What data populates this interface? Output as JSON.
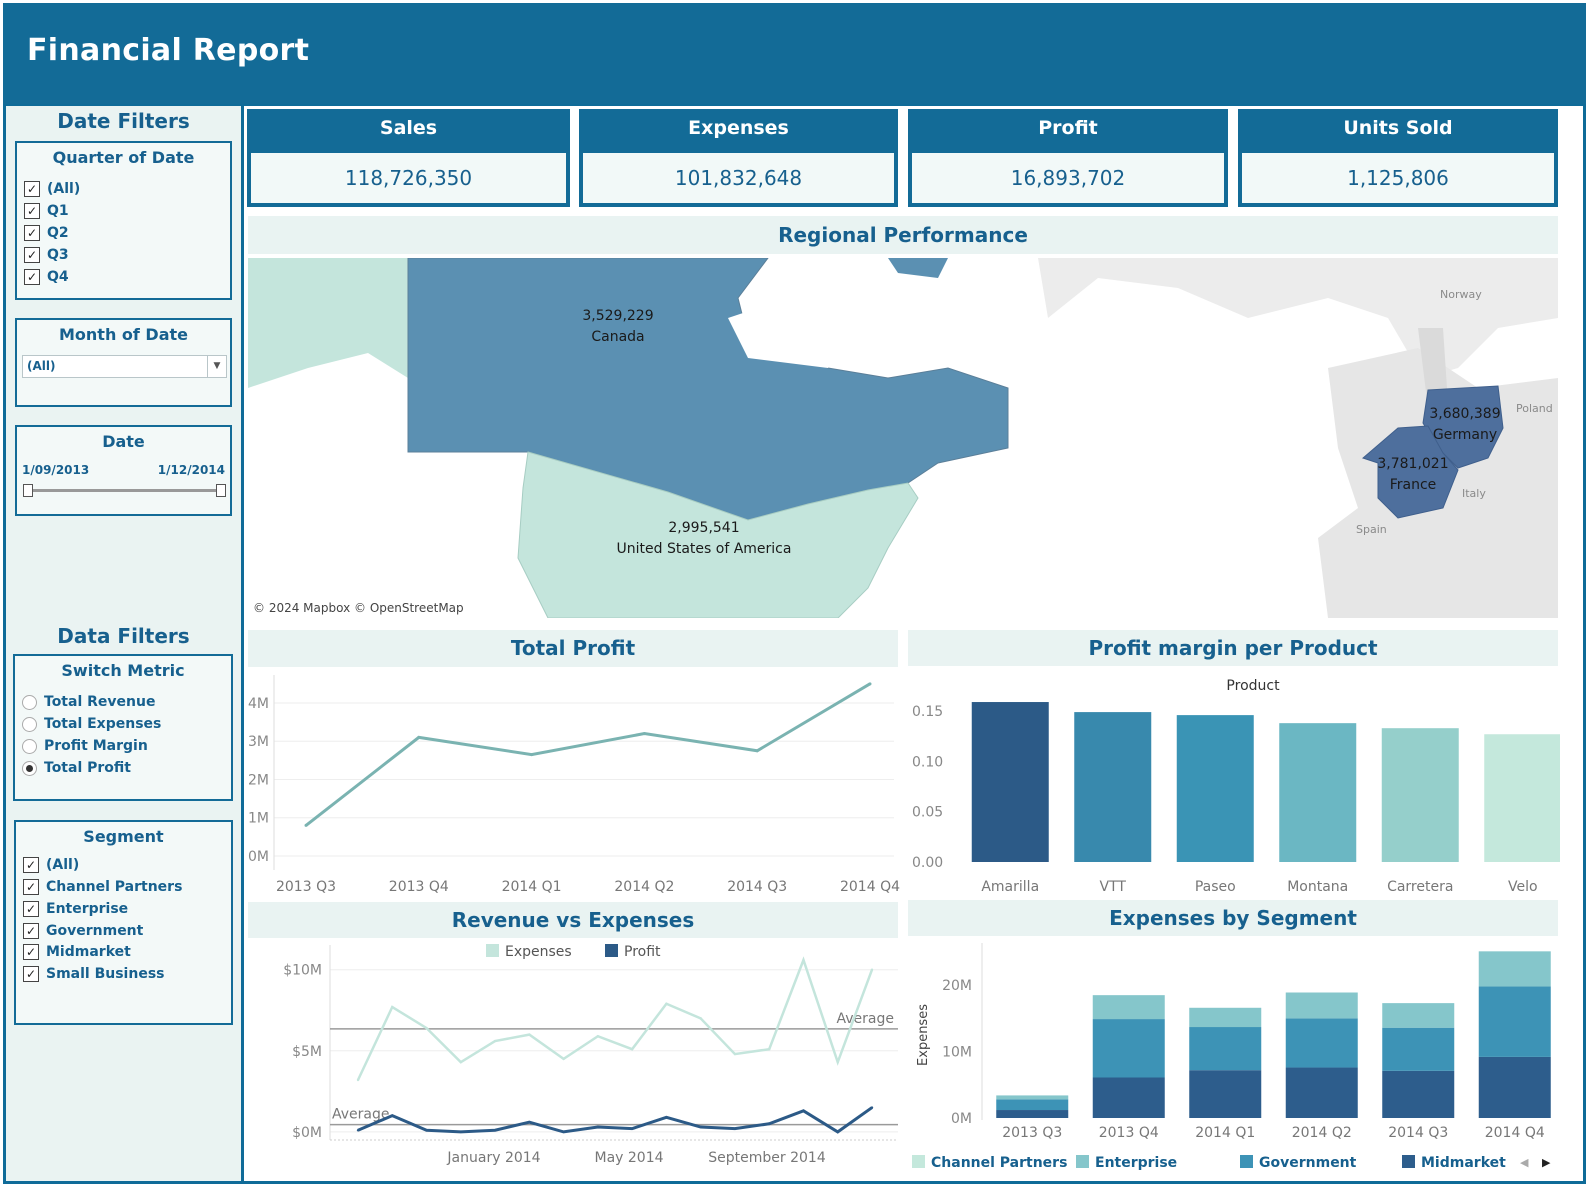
{
  "header": {
    "title": "Financial Report"
  },
  "sidebar": {
    "date_filters_heading": "Date Filters",
    "quarter": {
      "title": "Quarter of Date",
      "items": [
        "(All)",
        "Q1",
        "Q2",
        "Q3",
        "Q4"
      ]
    },
    "month": {
      "title": "Month of Date",
      "value": "(All)"
    },
    "date": {
      "title": "Date",
      "start": "1/09/2013",
      "end": "1/12/2014"
    },
    "data_filters_heading": "Data Filters",
    "switch_metric": {
      "title": "Switch Metric",
      "options": [
        "Total Revenue",
        "Total Expenses",
        "Profit Margin",
        "Total Profit"
      ],
      "selected": "Total Profit"
    },
    "segment": {
      "title": "Segment",
      "items": [
        "(All)",
        "Channel Partners",
        "Enterprise",
        "Government",
        "Midmarket",
        "Small Business"
      ]
    }
  },
  "kpis": [
    {
      "title": "Sales",
      "value": "118,726,350"
    },
    {
      "title": "Expenses",
      "value": "101,832,648"
    },
    {
      "title": "Profit",
      "value": "16,893,702"
    },
    {
      "title": "Units Sold",
      "value": "1,125,806"
    }
  ],
  "map": {
    "title": "Regional Performance",
    "attribution": "© 2024 Mapbox © OpenStreetMap",
    "regions": [
      {
        "name": "Canada",
        "value": "3,529,229"
      },
      {
        "name": "United States of America",
        "value": "2,995,541"
      },
      {
        "name": "Germany",
        "value": "3,680,389"
      },
      {
        "name": "France",
        "value": "3,781,021"
      }
    ],
    "basemap_labels": [
      "Norway",
      "Poland",
      "Italy",
      "Spain"
    ],
    "colors": {
      "canada": "#5b90b2",
      "usa": "#c4e5dc",
      "europe_selected": "#4e6f9d",
      "land": "#e6e6e6"
    }
  },
  "chart_data": [
    {
      "type": "line",
      "title": "Total Profit",
      "categories": [
        "2013 Q3",
        "2013 Q4",
        "2014 Q1",
        "2014 Q2",
        "2014 Q3",
        "2014 Q4"
      ],
      "series": [
        {
          "values": [
            0.8,
            3.1,
            2.65,
            3.2,
            2.75,
            4.5
          ]
        }
      ],
      "y_tick_labels": [
        "0M",
        "1M",
        "2M",
        "3M",
        "4M"
      ],
      "ylim": [
        0,
        4.6
      ],
      "unit": "millions",
      "color": "#7ab3b1"
    },
    {
      "type": "bar",
      "title": "Profit margin per Product",
      "header": "Product",
      "categories": [
        "Amarilla",
        "VTT",
        "Paseo",
        "Montana",
        "Carretera",
        "Velo"
      ],
      "values": [
        0.159,
        0.149,
        0.146,
        0.138,
        0.133,
        0.127
      ],
      "colors": [
        "#2c5a87",
        "#3889ad",
        "#3a94b5",
        "#6bb7c3",
        "#95cfcb",
        "#c4e8dc"
      ],
      "y_tick_labels": [
        "0.00",
        "0.05",
        "0.10",
        "0.15"
      ],
      "ylim": [
        0,
        0.165
      ]
    },
    {
      "type": "line",
      "title": "Revenue vs Expenses",
      "legend": [
        "Expenses",
        "Profit"
      ],
      "x_tick_labels": [
        "January 2014",
        "May 2014",
        "September 2014"
      ],
      "y_tick_labels": [
        "$0M",
        "$5M",
        "$10M"
      ],
      "ylim": [
        -0.5,
        10.6
      ],
      "series": [
        {
          "name": "Expenses",
          "color": "#c4e5dc",
          "values": [
            3.2,
            7.7,
            6.4,
            4.3,
            5.6,
            6.0,
            4.5,
            5.9,
            5.1,
            7.9,
            7.0,
            4.8,
            5.1,
            10.6,
            4.3,
            10.0
          ]
        },
        {
          "name": "Profit",
          "color": "#2c5a87",
          "values": [
            0.1,
            1.0,
            0.1,
            0.0,
            0.1,
            0.6,
            0.0,
            0.3,
            0.2,
            0.9,
            0.3,
            0.2,
            0.5,
            1.3,
            0.0,
            1.5
          ]
        }
      ],
      "averages": {
        "label": "Average",
        "expenses": 6.35,
        "profit": 0.45
      }
    },
    {
      "type": "bar",
      "title": "Expenses by Segment",
      "stacked": true,
      "ylabel": "Expenses",
      "categories": [
        "2013 Q3",
        "2013 Q4",
        "2014 Q1",
        "2014 Q2",
        "2014 Q3",
        "2014 Q4"
      ],
      "y_tick_labels": [
        "0M",
        "10M",
        "20M"
      ],
      "ylim": [
        0,
        25
      ],
      "legend": [
        "Channel Partners",
        "Enterprise",
        "Government",
        "Midmarket"
      ],
      "series": [
        {
          "name": "Midmarket",
          "color": "#2d5d8c",
          "values": [
            1.2,
            6.1,
            7.2,
            7.6,
            7.1,
            9.2
          ]
        },
        {
          "name": "Government",
          "color": "#3d93b6",
          "values": [
            1.6,
            8.8,
            6.5,
            7.4,
            6.5,
            10.6
          ]
        },
        {
          "name": "Enterprise",
          "color": "#85c6cb",
          "values": [
            0.6,
            3.6,
            2.9,
            3.9,
            3.7,
            5.3
          ]
        }
      ]
    }
  ]
}
